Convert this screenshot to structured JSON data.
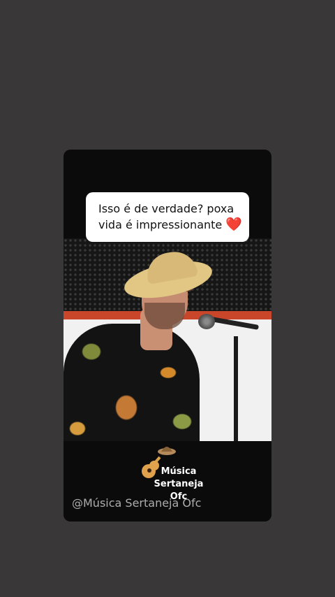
{
  "comment": {
    "line1": "Isso é de verdade? poxa",
    "line2": "vida é impressionante",
    "emoji": "❤️"
  },
  "logo": {
    "line1": "Música",
    "line2": "Sertaneja",
    "line3": "Ofc",
    "icon": "guitar-hat-icon"
  },
  "watermark": "@Música Sertaneja Ofc",
  "colors": {
    "background": "#3a3738",
    "card": "#0b0b0b",
    "bubble": "#ffffff",
    "heart": "#e8152b"
  }
}
